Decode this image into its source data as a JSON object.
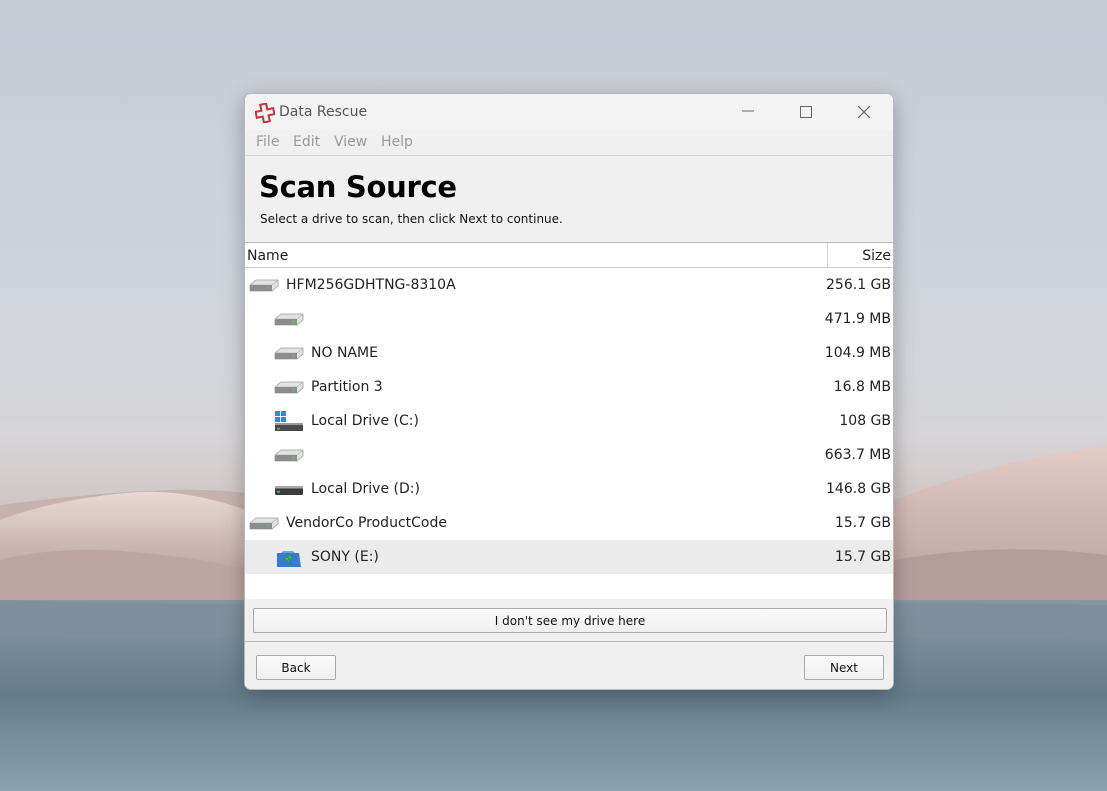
{
  "window": {
    "title": "Data Rescue",
    "controls": {
      "minimize": "minimize-icon",
      "maximize": "maximize-icon",
      "close": "close-icon"
    }
  },
  "menu": [
    "File",
    "Edit",
    "View",
    "Help"
  ],
  "header": {
    "title": "Scan Source",
    "subtitle": "Select a drive to scan, then click Next to continue."
  },
  "list": {
    "columns": {
      "name": "Name",
      "size": "Size"
    },
    "rows": [
      {
        "name": "HFM256GDHTNG-8310A",
        "size": "256.1 GB",
        "indent": 0,
        "icon": "disk-icon",
        "selected": false
      },
      {
        "name": "",
        "size": "471.9 MB",
        "indent": 1,
        "icon": "disk-icon",
        "selected": false
      },
      {
        "name": "NO NAME",
        "size": "104.9 MB",
        "indent": 1,
        "icon": "disk-icon",
        "selected": false
      },
      {
        "name": "Partition 3",
        "size": "16.8 MB",
        "indent": 1,
        "icon": "disk-icon",
        "selected": false
      },
      {
        "name": "Local Drive (C:)",
        "size": "108 GB",
        "indent": 1,
        "icon": "windows-drive-icon",
        "selected": false
      },
      {
        "name": "",
        "size": "663.7 MB",
        "indent": 1,
        "icon": "disk-icon",
        "selected": false
      },
      {
        "name": "Local Drive (D:)",
        "size": "146.8 GB",
        "indent": 1,
        "icon": "dark-drive-icon",
        "selected": false
      },
      {
        "name": "VendorCo ProductCode",
        "size": "15.7 GB",
        "indent": 0,
        "icon": "disk-icon",
        "selected": false
      },
      {
        "name": "SONY (E:)",
        "size": "15.7 GB",
        "indent": 1,
        "icon": "usb-drive-icon",
        "selected": true
      }
    ]
  },
  "buttons": {
    "no_drive": "I don't see my drive here",
    "back": "Back",
    "next": "Next"
  },
  "colors": {
    "brand": "#c8303a",
    "selected_row": "#ebebeb",
    "menu_text": "#9a9a9a"
  }
}
